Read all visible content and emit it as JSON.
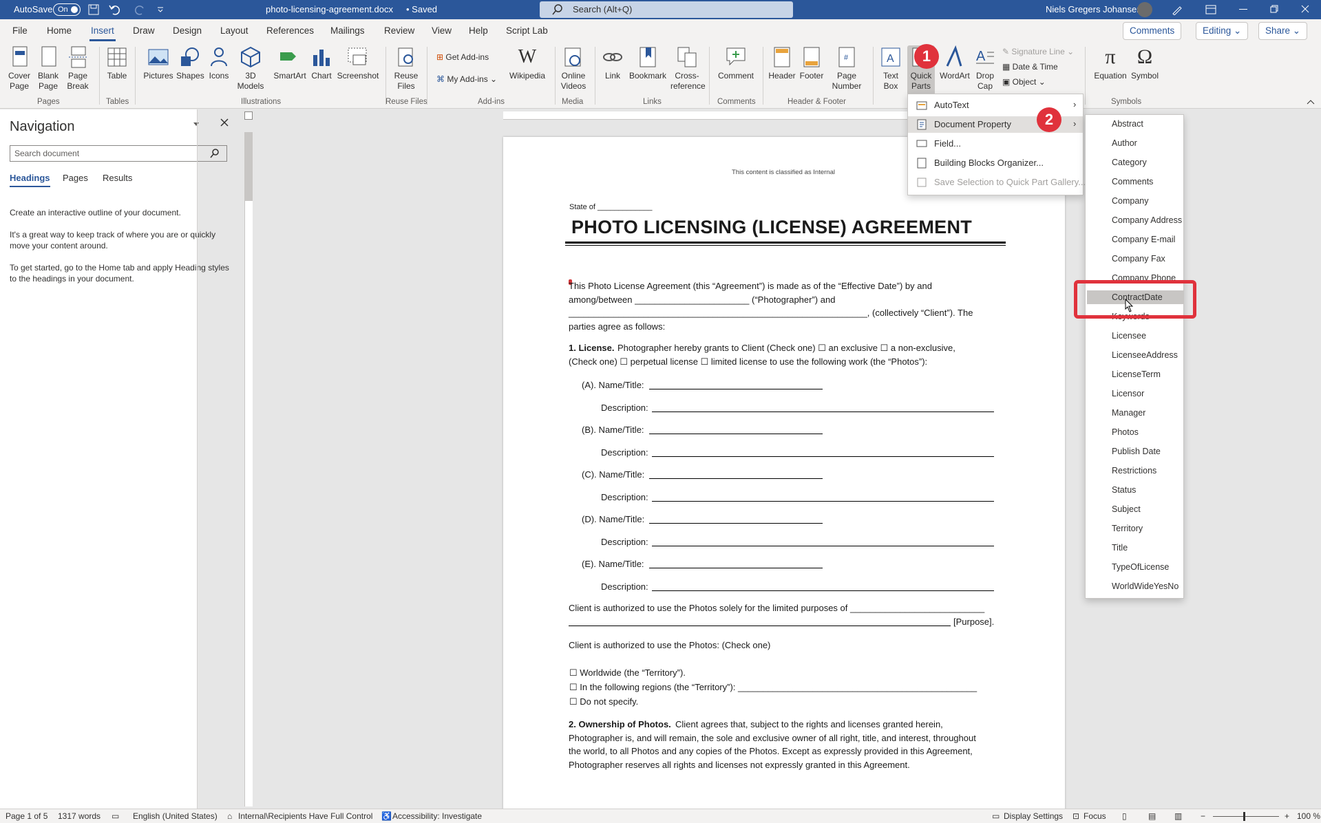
{
  "titlebar": {
    "autosave_label": "AutoSave",
    "autosave_state": "On",
    "filename": "photo-licensing-agreement.docx",
    "saved": "• Saved",
    "search_placeholder": "Search (Alt+Q)",
    "user": "Niels Gregers Johansen"
  },
  "tabs": [
    "File",
    "Home",
    "Insert",
    "Draw",
    "Design",
    "Layout",
    "References",
    "Mailings",
    "Review",
    "View",
    "Help",
    "Script Lab"
  ],
  "tab_actions": {
    "comments": "Comments",
    "editing": "Editing",
    "share": "Share"
  },
  "ribbon": {
    "pages": {
      "cover": "Cover Page",
      "blank": "Blank Page",
      "break": "Page Break",
      "label": "Pages"
    },
    "tables": {
      "table": "Table",
      "label": "Tables"
    },
    "illustrations": {
      "pictures": "Pictures",
      "shapes": "Shapes",
      "icons": "Icons",
      "models": "3D Models",
      "smartart": "SmartArt",
      "chart": "Chart",
      "screenshot": "Screenshot",
      "label": "Illustrations"
    },
    "reuse": {
      "reuse": "Reuse Files",
      "label": "Reuse Files"
    },
    "addins": {
      "get": "Get Add-ins",
      "my": "My Add-ins",
      "wikipedia": "Wikipedia",
      "label": "Add-ins"
    },
    "media": {
      "video": "Online Videos",
      "label": "Media"
    },
    "links": {
      "link": "Link",
      "bookmark": "Bookmark",
      "crossref": "Cross-reference",
      "label": "Links"
    },
    "comments": {
      "comment": "Comment",
      "label": "Comments"
    },
    "headerfooter": {
      "header": "Header",
      "footer": "Footer",
      "pagenum": "Page Number",
      "label": "Header & Footer"
    },
    "text": {
      "textbox": "Text Box",
      "quickparts": "Quick Parts",
      "wordart": "WordArt",
      "dropcap": "Drop Cap",
      "signature": "Signature Line",
      "datetime": "Date & Time",
      "object": "Object"
    },
    "symbols": {
      "equation": "Equation",
      "symbol": "Symbol",
      "label": "Symbols"
    }
  },
  "nav": {
    "title": "Navigation",
    "search_placeholder": "Search document",
    "tabs": [
      "Headings",
      "Pages",
      "Results"
    ],
    "p1": "Create an interactive outline of your document.",
    "p2a": "It's a great way to keep track of where you are or quickly",
    "p2b": "move your content around.",
    "p3a": "To get started, go to the Home tab and apply Heading styles",
    "p3b": "to the headings in your document."
  },
  "document": {
    "classification": "This content is classified as Internal",
    "state_of": "State of _____________",
    "title": "PHOTO LICENSING (LICENSE) AGREEMENT",
    "intro1": "This Photo License Agreement (this “Agreement”) is made as of the “Effective Date”) by and",
    "intro2": "among/between _______________________ (“Photographer”) and",
    "intro3": "____________________________________________________________, (collectively “Client”). The",
    "intro4": "parties agree as follows:",
    "s1_bold": "1. License.",
    "s1_text": "Photographer hereby grants to Client (Check one)  ☐  an exclusive   ☐  a non-exclusive,",
    "s1_text2": "(Check one)  ☐  perpetual license  ☐  limited license to use the following work (the “Photos”):",
    "items": [
      {
        "name": "(A). Name/Title:",
        "desc": "Description:"
      },
      {
        "name": "(B). Name/Title:",
        "desc": "Description:"
      },
      {
        "name": "(C). Name/Title:",
        "desc": "Description:"
      },
      {
        "name": "(D). Name/Title:",
        "desc": "Description:"
      },
      {
        "name": "(E). Name/Title:",
        "desc": "Description:"
      }
    ],
    "purpose1": "Client is authorized to use the Photos solely for the limited purposes of ___________________________",
    "purpose2": "[Purpose].",
    "territory_intro": "Client is authorized to use the Photos: (Check one)",
    "territory_opts": [
      "☐   Worldwide (the “Territory”).",
      "☐   In the following regions (the “Territory”): ________________________________________________",
      "☐   Do not specify."
    ],
    "s2_bold": "2. Ownership of Photos.",
    "s2_l1": "Client agrees that, subject to the rights and licenses granted herein,",
    "s2_l2": "Photographer is, and will remain, the sole and exclusive owner of all right, title, and interest, throughout",
    "s2_l3": "the world, to all Photos and any copies of the Photos. Except as expressly provided in this Agreement,",
    "s2_l4": "Photographer reserves all rights and licenses not expressly granted in this Agreement."
  },
  "quickparts_menu": [
    "AutoText",
    "Document Property",
    "Field...",
    "Building Blocks Organizer...",
    "Save Selection to Quick Part Gallery..."
  ],
  "doc_properties": [
    "Abstract",
    "Author",
    "Category",
    "Comments",
    "Company",
    "Company Address",
    "Company E-mail",
    "Company Fax",
    "Company Phone",
    "ContractDate",
    "Keywords",
    "Licensee",
    "LicenseeAddress",
    "LicenseTerm",
    "Licensor",
    "Manager",
    "Photos",
    "Publish Date",
    "Restrictions",
    "Status",
    "Subject",
    "Territory",
    "Title",
    "TypeOfLicense",
    "WorldWideYesNo"
  ],
  "highlighted_property": "ContractDate",
  "badges": [
    "1",
    "2"
  ],
  "status": {
    "page": "Page 1 of 5",
    "words": "1317 words",
    "language": "English (United States)",
    "sensitivity": "Internal\\Recipients Have Full Control",
    "accessibility": "Accessibility: Investigate",
    "display": "Display Settings",
    "focus": "Focus",
    "zoom": "100 %"
  },
  "colors": {
    "brand": "#2b579a",
    "highlight": "#e0323c"
  }
}
